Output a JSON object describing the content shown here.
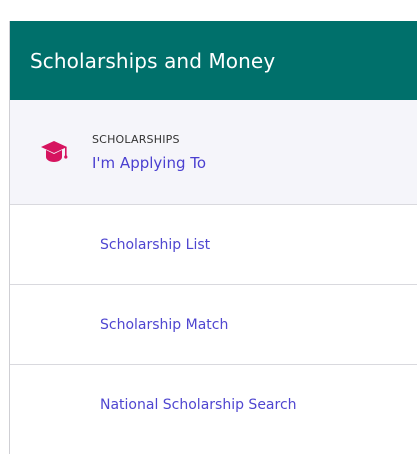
{
  "header": {
    "title": "Scholarships and Money"
  },
  "active_item": {
    "icon": "graduation-cap-icon",
    "category": "SCHOLARSHIPS",
    "label": "I'm Applying To"
  },
  "menu": {
    "items": [
      {
        "label": "Scholarship List"
      },
      {
        "label": "Scholarship Match"
      },
      {
        "label": "National Scholarship Search"
      }
    ]
  },
  "colors": {
    "header_bg": "#00706b",
    "icon": "#d6145f",
    "link": "#4a3fd0",
    "active_bg": "#f5f5fa"
  }
}
